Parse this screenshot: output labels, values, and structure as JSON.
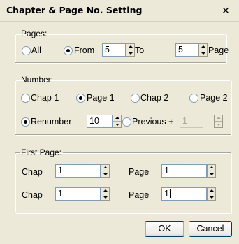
{
  "window": {
    "title": "Chapter & Page No. Setting",
    "close_glyph": "✕"
  },
  "pages": {
    "legend": "Pages:",
    "all_label": "All",
    "from_label": "From",
    "to_label": "To",
    "page_label": "Page",
    "from_value": "5",
    "to_value": "5",
    "selected": "from"
  },
  "number": {
    "legend": "Number:",
    "chap1_label": "Chap 1",
    "page1_label": "Page 1",
    "chap2_label": "Chap 2",
    "page2_label": "Page 2",
    "selected": "page1",
    "renumber_label": "Renumber",
    "renumber_value": "10",
    "previous_label": "Previous +",
    "previous_value": "1",
    "mode": "renumber"
  },
  "first_page": {
    "legend": "First Page:",
    "rows": [
      {
        "chap_label": "Chap",
        "chap_value": "1",
        "page_label": "Page",
        "page_value": "1"
      },
      {
        "chap_label": "Chap",
        "chap_value": "1",
        "page_label": "Page",
        "page_value": "1"
      }
    ]
  },
  "buttons": {
    "ok": "OK",
    "cancel": "Cancel"
  },
  "icons": {
    "close": "close-icon",
    "spin": "spin-arrows-icon"
  }
}
